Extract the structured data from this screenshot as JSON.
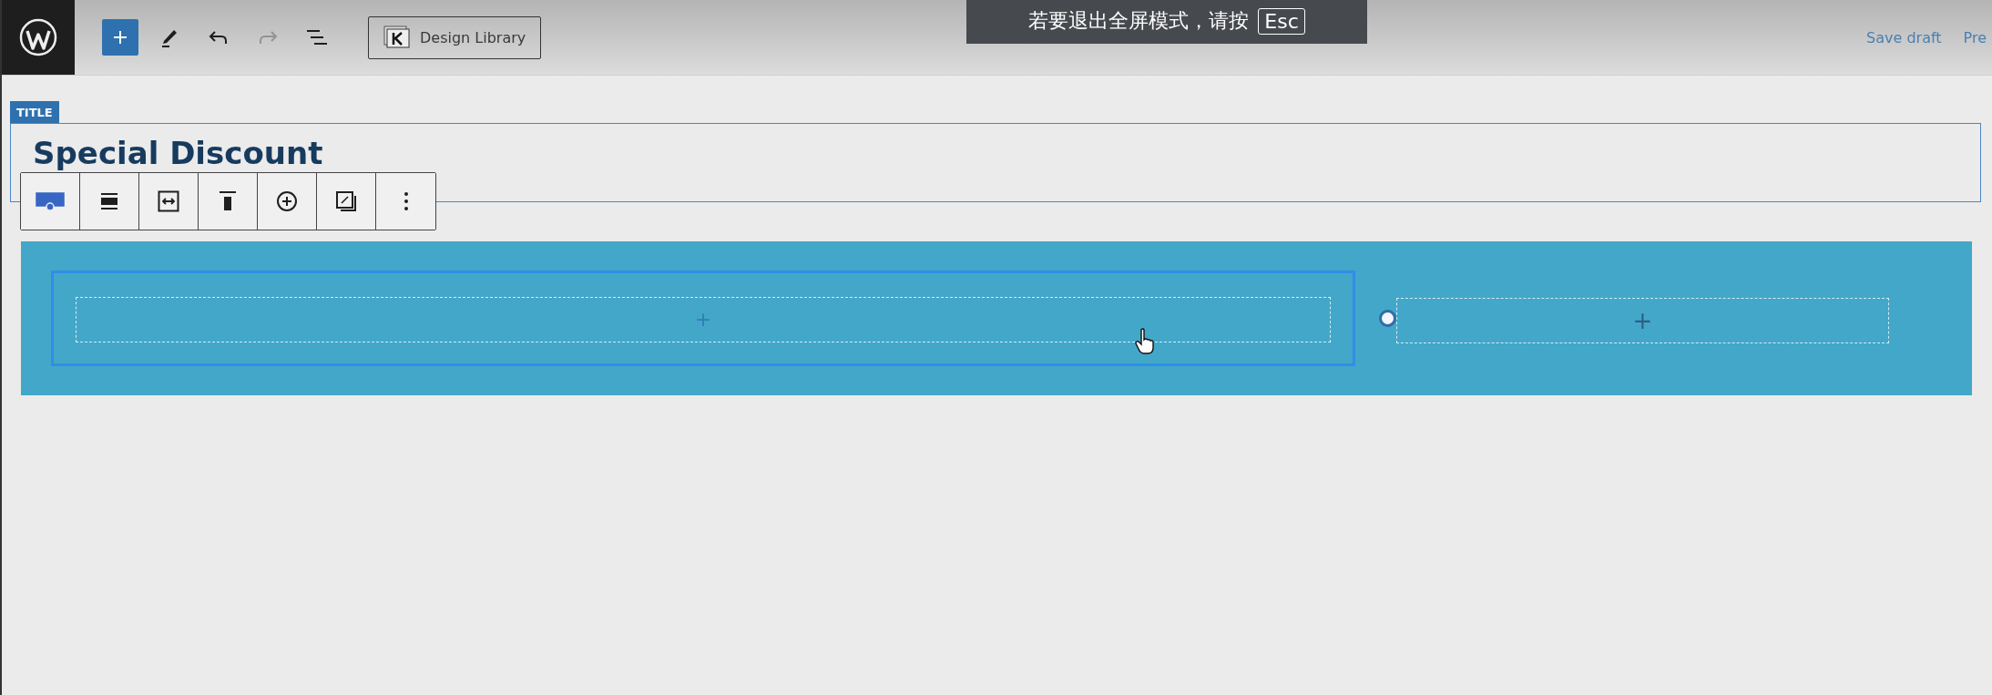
{
  "header": {
    "tools": [
      {
        "kind": "inserter",
        "disabled": false
      },
      {
        "kind": "pen",
        "disabled": false
      },
      {
        "kind": "undo",
        "disabled": false
      },
      {
        "kind": "redo",
        "disabled": true
      },
      {
        "kind": "list-view",
        "disabled": false
      }
    ],
    "design_library": "Design Library",
    "actions": [
      "Save draft",
      "Pre"
    ]
  },
  "fullscreen_notice": {
    "message": "若要退出全屏模式，请按",
    "key": "Esc"
  },
  "title_block": {
    "label": "TITLE",
    "text": "Special Discount"
  },
  "block_toolbar": [
    {
      "kind": "row",
      "selected": true
    },
    {
      "kind": "align",
      "selected": false
    },
    {
      "kind": "width",
      "selected": false
    },
    {
      "kind": "vertical",
      "selected": false
    },
    {
      "kind": "add",
      "selected": false
    },
    {
      "kind": "style",
      "selected": false
    },
    {
      "kind": "more",
      "selected": false
    }
  ],
  "row": {
    "columns": [
      {
        "appender": "+",
        "selected": true
      },
      {
        "appender": "+",
        "selected": false
      }
    ]
  }
}
